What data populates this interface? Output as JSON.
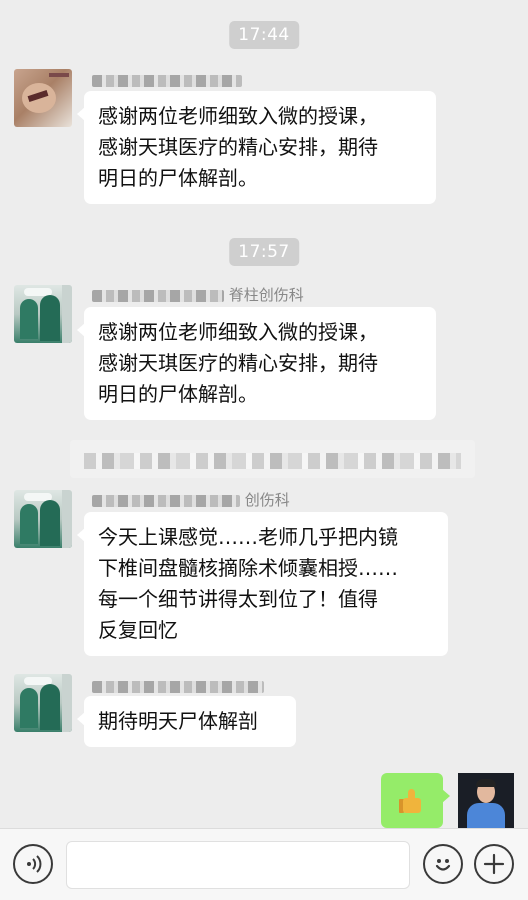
{
  "times": [
    "17:44",
    "17:57"
  ],
  "messages": [
    {
      "sender_suffix": "",
      "text": [
        "感谢两位老师细致入微的授课，",
        "感谢天琪医疗的精心安排，期待",
        "明日的尸体解剖。"
      ]
    },
    {
      "sender_suffix": "脊柱创伤科",
      "text": [
        "感谢两位老师细致入微的授课，",
        "感谢天琪医疗的精心安排，期待",
        "明日的尸体解剖。"
      ]
    },
    {
      "sender_suffix": "创伤科",
      "text": [
        "今天上课感觉……老师几乎把内镜",
        "下椎间盘髓核摘除术倾囊相授……",
        "每一个细节讲得太到位了！值得",
        "反复回忆"
      ]
    },
    {
      "sender_suffix": "",
      "text": [
        "期待明天尸体解剖"
      ]
    }
  ],
  "self_message": {
    "icon": "thumbs-up-icon"
  },
  "input": {
    "value": "",
    "placeholder": ""
  },
  "colors": {
    "background": "#ededed",
    "self_bubble": "#95ec69",
    "time_pill": "#cfcfcf"
  }
}
